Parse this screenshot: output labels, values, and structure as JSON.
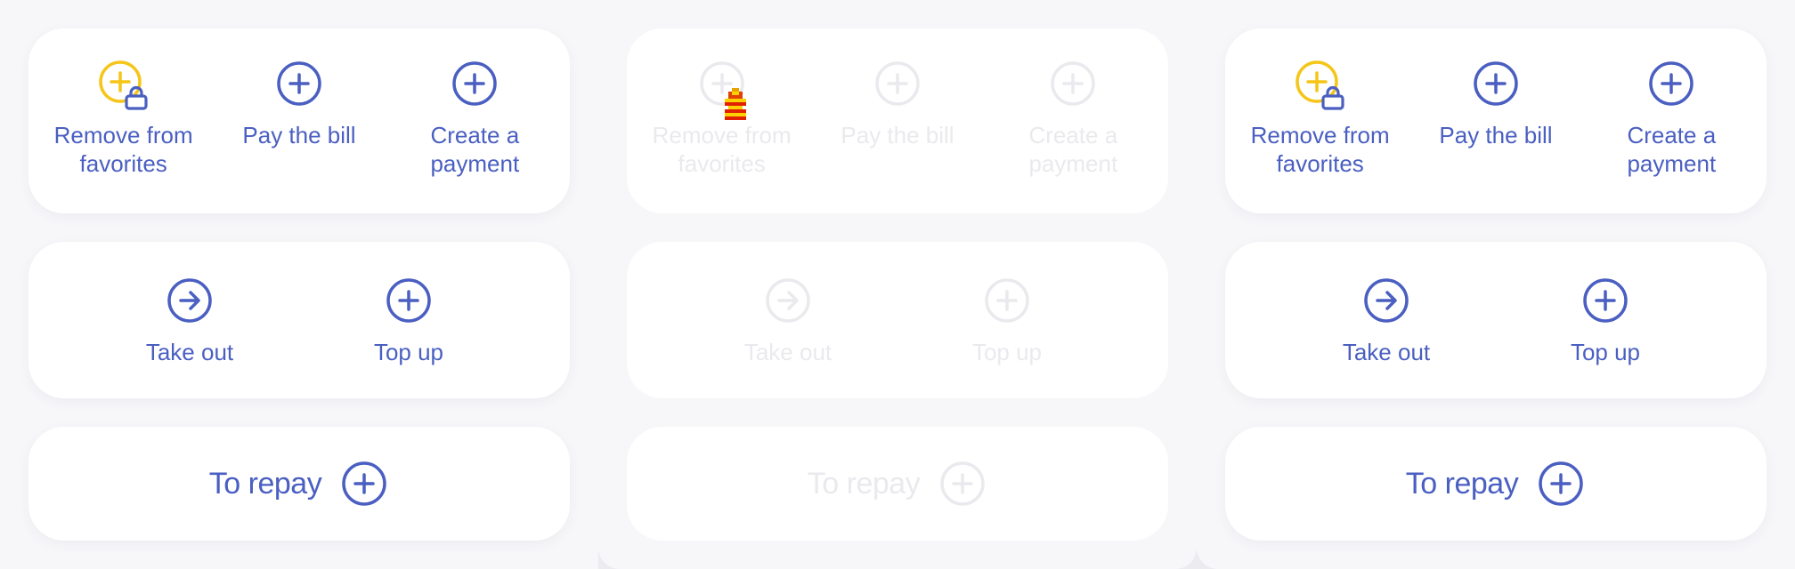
{
  "colors": {
    "accent": "#4a5fc1",
    "favorite_yellow": "#f5c518",
    "disabled_text": "#eaeaee",
    "card_bg": "#ffffff",
    "panel_bg": "#f7f7f9"
  },
  "panels": [
    {
      "state": "default",
      "actions": [
        {
          "label": "Remove from\nfavorites",
          "icon": "plus-circle-lock-icon"
        },
        {
          "label": "Pay the bill",
          "icon": "plus-circle-icon"
        },
        {
          "label": "Create a\npayment",
          "icon": "plus-circle-icon"
        }
      ],
      "transfer": [
        {
          "label": "Take out",
          "icon": "arrow-right-circle-icon"
        },
        {
          "label": "Top up",
          "icon": "plus-circle-icon"
        }
      ],
      "repay": {
        "label": "To repay",
        "icon": "plus-circle-icon"
      }
    },
    {
      "state": "disabled",
      "actions": [
        {
          "label": "Remove from\nfavorites",
          "icon": "plus-circle-icon"
        },
        {
          "label": "Pay the bill",
          "icon": "plus-circle-icon"
        },
        {
          "label": "Create a\npayment",
          "icon": "plus-circle-icon"
        }
      ],
      "transfer": [
        {
          "label": "Take out",
          "icon": "arrow-right-circle-icon"
        },
        {
          "label": "Top up",
          "icon": "plus-circle-icon"
        }
      ],
      "repay": {
        "label": "To repay",
        "icon": "plus-circle-icon"
      }
    },
    {
      "state": "default",
      "actions": [
        {
          "label": "Remove from\nfavorites",
          "icon": "plus-circle-lock-icon"
        },
        {
          "label": "Pay the bill",
          "icon": "plus-circle-icon"
        },
        {
          "label": "Create a\npayment",
          "icon": "plus-circle-icon"
        }
      ],
      "transfer": [
        {
          "label": "Take out",
          "icon": "arrow-right-circle-icon"
        },
        {
          "label": "Top up",
          "icon": "plus-circle-icon"
        }
      ],
      "repay": {
        "label": "To repay",
        "icon": "plus-circle-icon"
      }
    }
  ],
  "overlay": {
    "icon": "pixel-figure-icon"
  }
}
